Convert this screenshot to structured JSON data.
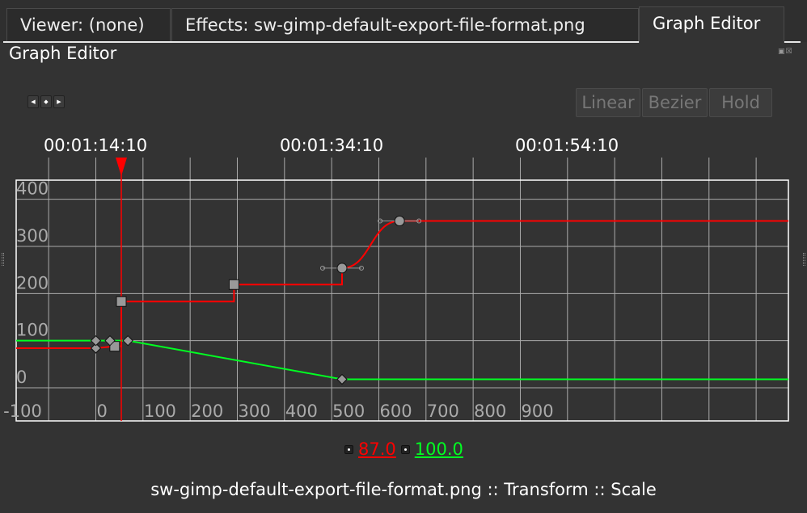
{
  "tabs": [
    {
      "label": "Viewer: (none)"
    },
    {
      "label": "Effects: sw-gimp-default-export-file-format.png"
    },
    {
      "label": "Graph Editor",
      "active": true
    }
  ],
  "panel": {
    "title": "Graph Editor"
  },
  "toolbar": {
    "prev_icon": "triangle-left",
    "key_icon": "diamond",
    "next_icon": "triangle-right",
    "linear": "Linear",
    "bezier": "Bezier",
    "hold": "Hold"
  },
  "timeline": {
    "labels": [
      "00:01:14:10",
      "00:01:34:10",
      "00:01:54:10"
    ]
  },
  "chart_data": {
    "type": "line",
    "x_ticks": [
      "-100",
      "0",
      "100",
      "200",
      "300",
      "400",
      "500",
      "600",
      "700",
      "800",
      "900"
    ],
    "y_ticks": [
      "400",
      "300",
      "200",
      "100",
      "0"
    ],
    "grid": true,
    "playhead": 54,
    "playhead_color": "#ff0000",
    "series": [
      {
        "color": "#ff0000",
        "start_value": 84,
        "keyframes": [
          {
            "t": 0,
            "v": 84,
            "shape": "diamond",
            "interp": "linear"
          },
          {
            "t": 40,
            "v": 88,
            "shape": "square",
            "interp": "hold"
          },
          {
            "t": 54,
            "v": 183,
            "shape": "square",
            "interp": "hold"
          },
          {
            "t": 293,
            "v": 219,
            "shape": "square",
            "interp": "hold"
          },
          {
            "t": 522,
            "v": 254,
            "shape": "circle",
            "interp": "bezier"
          },
          {
            "t": 644,
            "v": 354,
            "shape": "circle",
            "interp": "hold"
          }
        ]
      },
      {
        "color": "#00ff22",
        "start_value": 100,
        "keyframes": [
          {
            "t": 0,
            "v": 100,
            "shape": "diamond",
            "interp": "linear"
          },
          {
            "t": 30,
            "v": 100,
            "shape": "diamond",
            "interp": "linear"
          },
          {
            "t": 68,
            "v": 100,
            "shape": "diamond",
            "interp": "linear"
          },
          {
            "t": 522,
            "v": 18,
            "shape": "diamond",
            "interp": "linear"
          }
        ]
      }
    ]
  },
  "values": {
    "red": "87.0",
    "green": "100.0",
    "red_color": "#ff0000",
    "green_color": "#00ff22"
  },
  "footer": "sw-gimp-default-export-file-format.png :: Transform :: Scale"
}
